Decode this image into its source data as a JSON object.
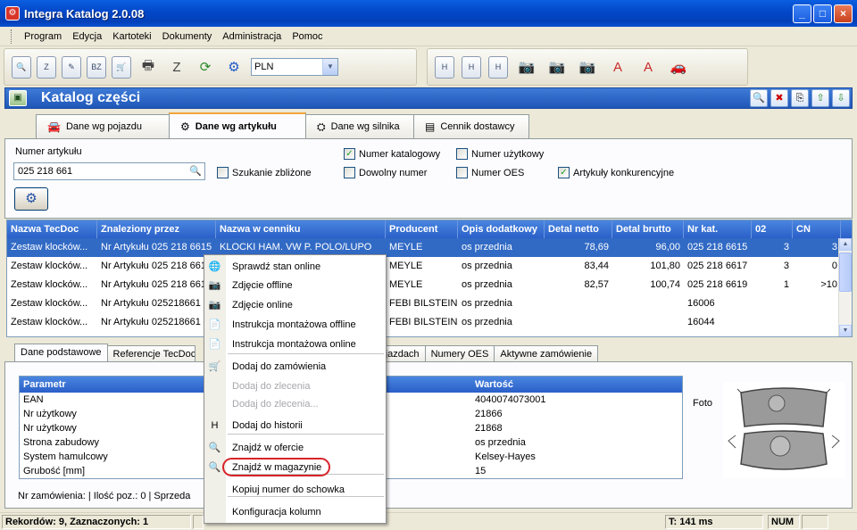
{
  "window": {
    "title": "Integra Katalog 2.0.08",
    "app_icon_glyph": "⚙"
  },
  "menu": [
    "Program",
    "Edycja",
    "Kartoteki",
    "Dokumenty",
    "Administracja",
    "Pomoc"
  ],
  "toolbar": {
    "currency_value": "PLN"
  },
  "section": {
    "title": "Katalog części"
  },
  "tabs": [
    {
      "label": "Dane wg pojazdu",
      "icon": "car-icon"
    },
    {
      "label": "Dane wg artykułu",
      "icon": "gear-icon"
    },
    {
      "label": "Dane wg silnika",
      "icon": "engine-icon"
    },
    {
      "label": "Cennik dostawcy",
      "icon": "list-icon"
    }
  ],
  "search": {
    "label": "Numer artykułu",
    "value": "025 218 661",
    "fuzzy_label": "Szukanie zbliżone",
    "fuzzy_checked": false
  },
  "filters": [
    {
      "label": "Numer katalogowy",
      "checked": true
    },
    {
      "label": "Numer użytkowy",
      "checked": false
    },
    {
      "label": "Dowolny numer",
      "checked": false
    },
    {
      "label": "Numer OES",
      "checked": false
    },
    {
      "label": "Artykuły konkurencyjne",
      "checked": true
    }
  ],
  "grid": {
    "columns": [
      "Nazwa TecDoc",
      "Znaleziony przez",
      "Nazwa w cenniku",
      "Producent",
      "Opis dodatkowy",
      "Detal netto",
      "Detal brutto",
      "Nr kat.",
      "02",
      "CN"
    ],
    "rows": [
      [
        "Zestaw klocków...",
        "Nr Artykułu 025 218 6615",
        "KLOCKI HAM. VW P. POLO/LUPO",
        "MEYLE",
        "os przednia",
        "78,69",
        "96,00",
        "025 218 6615",
        "3",
        "3"
      ],
      [
        "Zestaw klocków...",
        "Nr Artykułu 025 218 661",
        "",
        "MEYLE",
        "os przednia",
        "83,44",
        "101,80",
        "025 218 6617",
        "3",
        "0"
      ],
      [
        "Zestaw klocków...",
        "Nr Artykułu 025 218 661",
        "",
        "MEYLE",
        "os przednia",
        "82,57",
        "100,74",
        "025 218 6619",
        "1",
        ">10"
      ],
      [
        "Zestaw klocków...",
        "Nr Artykułu 025218661",
        "",
        "FEBI BILSTEIN",
        "os przednia",
        "",
        "",
        "16006",
        "",
        ""
      ],
      [
        "Zestaw klocków...",
        "Nr Artykułu 025218661",
        "",
        "FEBI BILSTEIN",
        "os przednia",
        "",
        "",
        "16044",
        "",
        ""
      ]
    ],
    "selected_row": 0
  },
  "subtabs": [
    "Dane podstawowe",
    "Referencje TecDoc",
    "ojazdach",
    "Numery OES",
    "Aktywne zamówienie"
  ],
  "params": {
    "col_param": "Parametr",
    "col_value": "Wartość",
    "rows": [
      [
        "EAN",
        "4040074073001"
      ],
      [
        "Nr użytkowy",
        "21866"
      ],
      [
        "Nr użytkowy",
        "21868"
      ],
      [
        "Strona zabudowy",
        "os przednia"
      ],
      [
        "System hamulcowy",
        "Kelsey-Hayes"
      ],
      [
        "Grubość [mm]",
        "15"
      ]
    ]
  },
  "foto_label": "Foto",
  "footer": "Nr zamówienia:   |  Ilość poz.: 0  |  Sprzeda",
  "status": {
    "records": "Rekordów: 9, Zaznaczonych: 1",
    "time": "T: 141 ms",
    "num": "NUM"
  },
  "context_menu": [
    {
      "label": "Sprawdź stan online",
      "icon": "globe-icon",
      "disabled": false
    },
    {
      "label": "Zdjęcie offline",
      "icon": "camera-icon",
      "disabled": false
    },
    {
      "label": "Zdjęcie online",
      "icon": "camera-globe-icon",
      "disabled": false
    },
    {
      "label": "Instrukcja montażowa offline",
      "icon": "pdf-icon",
      "disabled": false
    },
    {
      "label": "Instrukcja montażowa online",
      "icon": "pdf-globe-icon",
      "disabled": false
    },
    {
      "label": "Dodaj do zamówienia",
      "icon": "cart-add-icon",
      "disabled": false
    },
    {
      "label": "Dodaj do zlecenia",
      "icon": "",
      "disabled": true
    },
    {
      "label": "Dodaj do zlecenia...",
      "icon": "",
      "disabled": true
    },
    {
      "label": "Dodaj do historii",
      "icon": "history-icon",
      "disabled": false
    },
    {
      "label": "Znajdź w ofercie",
      "icon": "search-icon",
      "disabled": false
    },
    {
      "label": "Znajdź w magazynie",
      "icon": "search-icon",
      "disabled": false
    },
    {
      "label": "Kopiuj numer do schowka",
      "icon": "",
      "disabled": false
    },
    {
      "label": "Konfiguracja kolumn",
      "icon": "",
      "disabled": false
    }
  ]
}
